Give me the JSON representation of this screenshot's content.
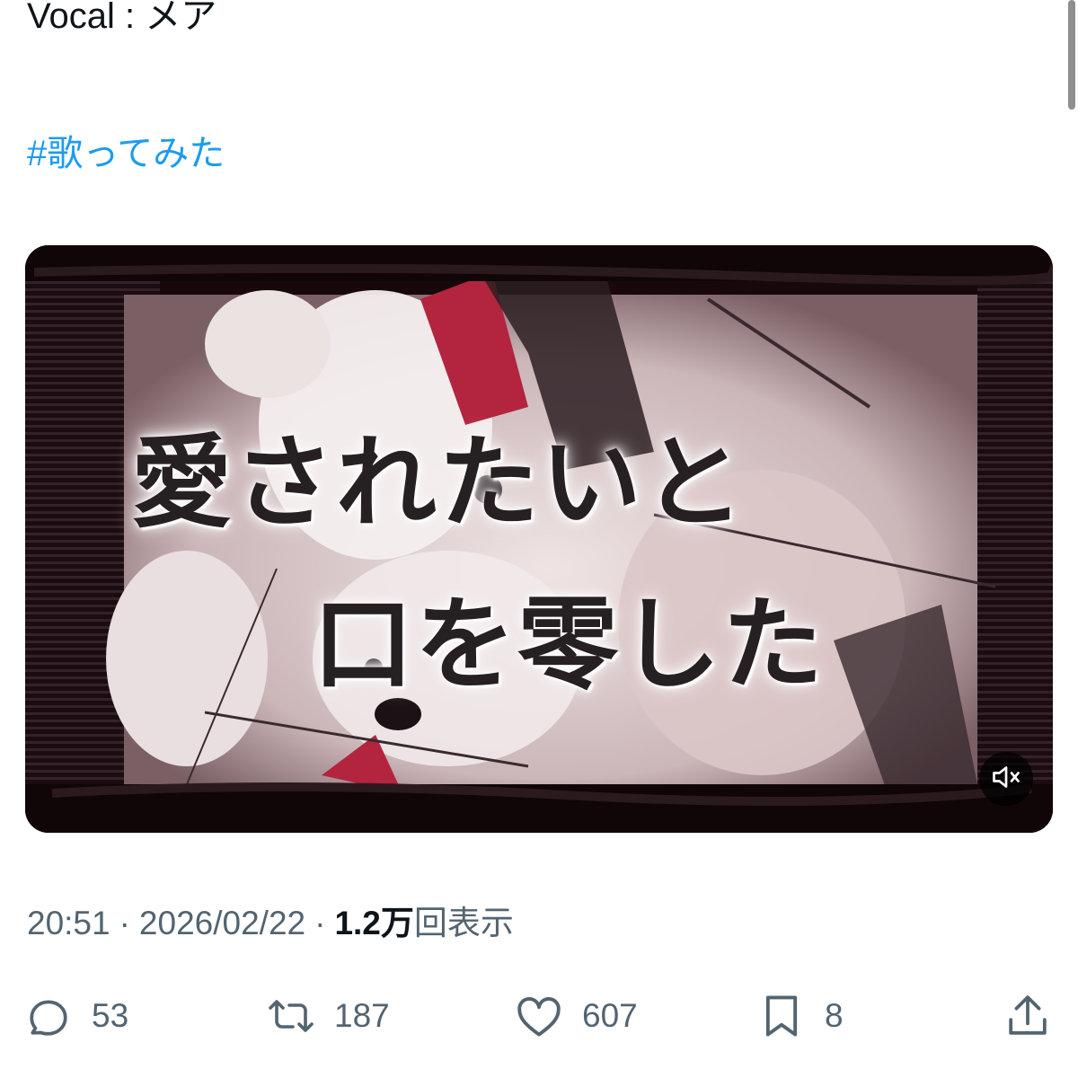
{
  "tweet": {
    "vocal_line": "Vocal : メア",
    "hashtag": "#歌ってみた"
  },
  "video": {
    "lyric_line1": "愛されたいと",
    "lyric_line2": "口を零した",
    "mute_icon": "speaker-muted-icon"
  },
  "meta": {
    "time": "20:51",
    "separator": "·",
    "date": "2026/02/22",
    "views_count": "1.2万",
    "views_label": "回表示"
  },
  "actions": {
    "reply": {
      "icon": "reply-icon",
      "count": "53"
    },
    "retweet": {
      "icon": "retweet-icon",
      "count": "187"
    },
    "like": {
      "icon": "heart-icon",
      "count": "607"
    },
    "bookmark": {
      "icon": "bookmark-icon",
      "count": "8"
    },
    "share": {
      "icon": "share-icon"
    }
  },
  "colors": {
    "link": "#1d9bf0",
    "text": "#0f1419",
    "secondary": "#536471",
    "video_bg": "#17080c",
    "accent_red": "#b3243f"
  }
}
